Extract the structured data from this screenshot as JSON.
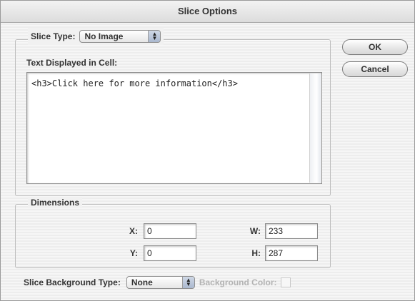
{
  "window": {
    "title": "Slice Options"
  },
  "slice_type": {
    "label": "Slice Type:",
    "selected": "No Image"
  },
  "text_cell": {
    "label": "Text Displayed in Cell:",
    "value": "<h3>Click here for more information</h3>"
  },
  "buttons": {
    "ok": "OK",
    "cancel": "Cancel"
  },
  "dimensions": {
    "label": "Dimensions",
    "x_label": "X:",
    "x_value": "0",
    "y_label": "Y:",
    "y_value": "0",
    "w_label": "W:",
    "w_value": "233",
    "h_label": "H:",
    "h_value": "287"
  },
  "background": {
    "type_label": "Slice Background Type:",
    "type_selected": "None",
    "color_label": "Background Color:"
  }
}
